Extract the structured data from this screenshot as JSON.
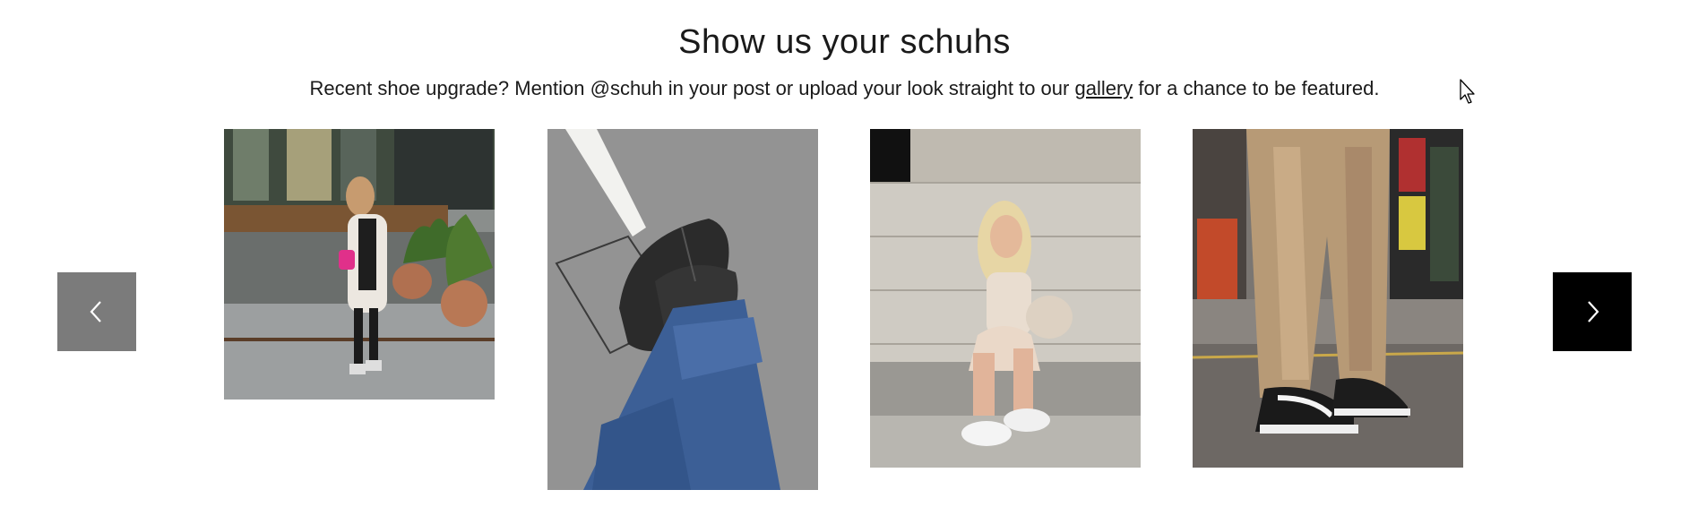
{
  "section": {
    "title": "Show us your schuhs",
    "subtitle_before": "Recent shoe upgrade? Mention @schuh in your post or upload your look straight to our ",
    "gallery_link": "gallery",
    "subtitle_after": " for a chance to be featured."
  },
  "carousel": {
    "prev_icon": "chevron-left-icon",
    "next_icon": "chevron-right-icon",
    "tiles": [
      {
        "name": "ugc-photo-1",
        "desc_icon": "photo"
      },
      {
        "name": "ugc-photo-2",
        "desc_icon": "photo"
      },
      {
        "name": "ugc-photo-3",
        "desc_icon": "photo"
      },
      {
        "name": "ugc-photo-4",
        "desc_icon": "photo"
      }
    ]
  },
  "colors": {
    "prev_bg": "#7b7b7b",
    "next_bg": "#000000",
    "text": "#1a1a1a"
  }
}
